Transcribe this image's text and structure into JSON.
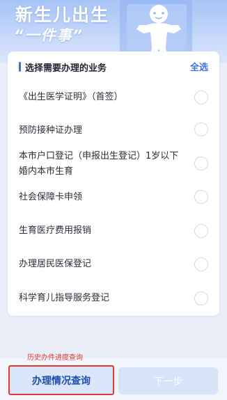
{
  "banner": {
    "title": "新生儿出生",
    "subtitle": "“一件事”",
    "art_icon": "baby-illustration-icon"
  },
  "section": {
    "title": "选择需要办理的业务",
    "select_all": "全选"
  },
  "items": [
    {
      "label": "《出生医学证明》（首签）",
      "checked": false
    },
    {
      "label": "预防接种证办理",
      "checked": false
    },
    {
      "label": "本市户口登记（申报出生登记）1岁以下婚内本市生育",
      "checked": false
    },
    {
      "label": "社会保障卡申领",
      "checked": false
    },
    {
      "label": "生育医疗费用报销",
      "checked": false
    },
    {
      "label": "办理居民医保登记",
      "checked": false
    },
    {
      "label": "科学育儿指导服务登记",
      "checked": false
    }
  ],
  "footer": {
    "history_link": "历史办件进度查询",
    "query_button": "办理情况查询",
    "next_button": "下一步"
  },
  "colors": {
    "accent": "#3a73e8",
    "highlight_border": "#e23b2e",
    "history_text": "#e03a2f"
  }
}
